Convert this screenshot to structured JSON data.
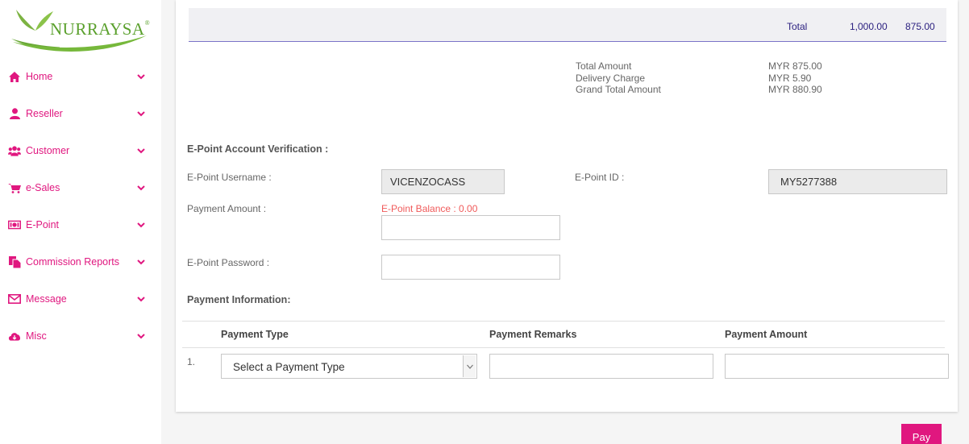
{
  "brand": {
    "name": "NURRAYSA",
    "registered_mark": "®",
    "primary_color": "#e0177f",
    "logo_green": "#5aa02c"
  },
  "sidebar": {
    "items": [
      {
        "label": "Home",
        "icon": "home-icon"
      },
      {
        "label": "Reseller",
        "icon": "user-icon"
      },
      {
        "label": "Customer",
        "icon": "users-icon"
      },
      {
        "label": "e-Sales",
        "icon": "cart-icon"
      },
      {
        "label": "E-Point",
        "icon": "money-icon"
      },
      {
        "label": "Commission Reports",
        "icon": "copy-icon"
      },
      {
        "label": "Message",
        "icon": "envelope-icon"
      },
      {
        "label": "Misc",
        "icon": "cloud-download-icon"
      }
    ]
  },
  "totals": {
    "label": "Total",
    "value1": "1,000.00",
    "value2": "875.00"
  },
  "summary": {
    "total_amount_label": "Total Amount",
    "total_amount_value": "MYR 875.00",
    "delivery_label": "Delivery Charge",
    "delivery_value": "MYR 5.90",
    "grand_total_label": "Grand Total Amount",
    "grand_total_value": "MYR 880.90"
  },
  "verification": {
    "title": "E-Point Account Verification :",
    "username_label": "E-Point Username :",
    "username_value": "VICENZOCASS",
    "id_label": "E-Point ID :",
    "id_value": "MY5277388",
    "payment_amount_label": "Payment Amount :",
    "balance_text": "E-Point Balance : 0.00",
    "payment_amount_value": "",
    "password_label": "E-Point Password :",
    "password_value": ""
  },
  "payment_info": {
    "title": "Payment Information:",
    "columns": [
      "Payment Type",
      "Payment Remarks",
      "Payment Amount"
    ],
    "rows": [
      {
        "number": "1.",
        "type_selected": "Select a Payment Type",
        "remarks": "",
        "amount": ""
      }
    ]
  },
  "actions": {
    "pay_label": "Pay"
  }
}
